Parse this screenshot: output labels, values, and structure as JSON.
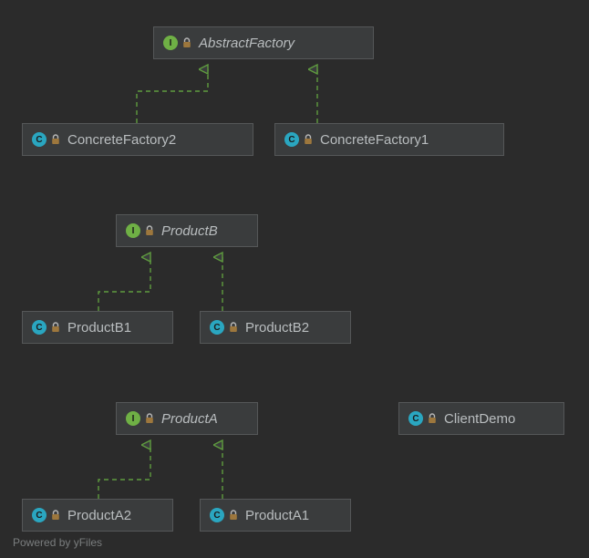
{
  "footer": {
    "text": "Powered by yFiles"
  },
  "badge_letters": {
    "interface": "I",
    "class": "C"
  },
  "colors": {
    "background": "#2b2b2b",
    "node_fill": "#3a3c3d",
    "node_border": "#555758",
    "text": "#b9bdbf",
    "interface_badge": "#6fb045",
    "class_badge": "#2aa6c0",
    "edge": "#5f9c3f",
    "lock_body": "#9d773d",
    "lock_shackle": "#b7b7b7"
  },
  "nodes": {
    "abstract_factory": {
      "label": "AbstractFactory",
      "kind": "interface",
      "italic": true
    },
    "concrete_factory_2": {
      "label": "ConcreteFactory2",
      "kind": "class",
      "italic": false
    },
    "concrete_factory_1": {
      "label": "ConcreteFactory1",
      "kind": "class",
      "italic": false
    },
    "product_b": {
      "label": "ProductB",
      "kind": "interface",
      "italic": true
    },
    "product_b1": {
      "label": "ProductB1",
      "kind": "class",
      "italic": false
    },
    "product_b2": {
      "label": "ProductB2",
      "kind": "class",
      "italic": false
    },
    "product_a": {
      "label": "ProductA",
      "kind": "interface",
      "italic": true
    },
    "product_a2": {
      "label": "ProductA2",
      "kind": "class",
      "italic": false
    },
    "product_a1": {
      "label": "ProductA1",
      "kind": "class",
      "italic": false
    },
    "client_demo": {
      "label": "ClientDemo",
      "kind": "class",
      "italic": false
    }
  },
  "edges": [
    {
      "from": "concrete_factory_2",
      "to": "abstract_factory"
    },
    {
      "from": "concrete_factory_1",
      "to": "abstract_factory"
    },
    {
      "from": "product_b1",
      "to": "product_b"
    },
    {
      "from": "product_b2",
      "to": "product_b"
    },
    {
      "from": "product_a2",
      "to": "product_a"
    },
    {
      "from": "product_a1",
      "to": "product_a"
    }
  ]
}
